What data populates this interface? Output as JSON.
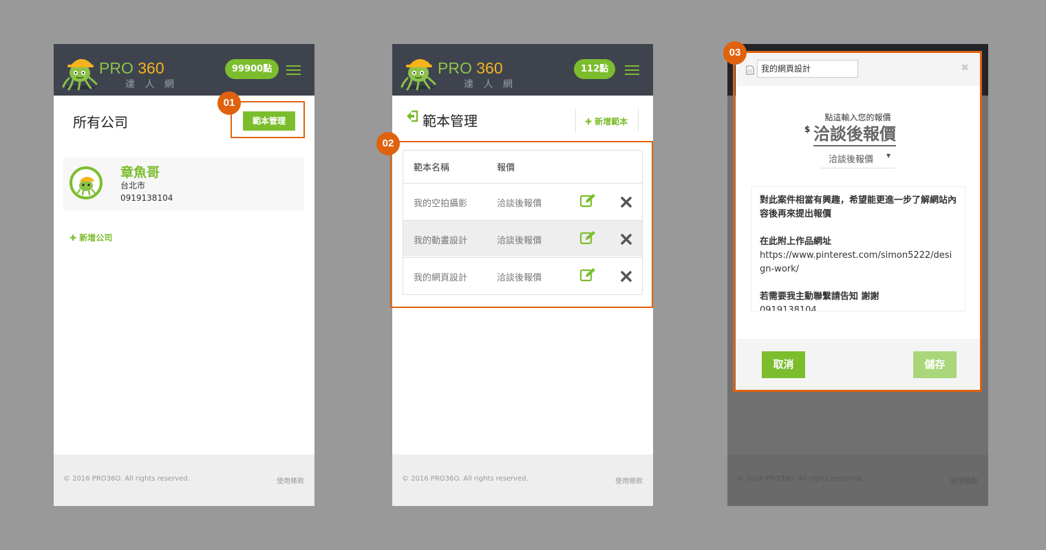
{
  "brand": {
    "name": "PRO",
    "name_num": "360",
    "subtitle": "達 人 網"
  },
  "colors": {
    "accent": "#7cbd2e",
    "accent_light": "#a9d77a",
    "header": "#3f434e",
    "annotation": "#e0620e",
    "brand_yellow": "#f5b41d"
  },
  "footer": {
    "copyright": "© 2016 PRO36O. All rights reserved.",
    "terms": "使用條款"
  },
  "screen1": {
    "points": "99900點",
    "title": "所有公司",
    "manage_button": "範本管理",
    "company": {
      "name": "章魚哥",
      "city": "台北市",
      "phone": "0919138104"
    },
    "add_company": "新增公司",
    "badge": "01"
  },
  "screen2": {
    "points": "112點",
    "title": "範本管理",
    "add_template": "新增範本",
    "columns": {
      "name": "範本名稱",
      "price": "報價"
    },
    "rows": [
      {
        "name": "我的空拍攝影",
        "price": "洽談後報價"
      },
      {
        "name": "我的動畫設計",
        "price": "洽談後報價"
      },
      {
        "name": "我的網頁設計",
        "price": "洽談後報價"
      }
    ],
    "badge": "02"
  },
  "screen3": {
    "template_name": "我的網頁設計",
    "close": "✖",
    "prompt": "點這輸入您的報價",
    "currency": "$",
    "price_text": "洽談後報價",
    "price_option": "洽談後報價",
    "message": {
      "p1": "對此案件相當有興趣，希望能更進一步了解網站內容後再來提出報價",
      "p2_title": "在此附上作品網址",
      "p2_url": "https://www.pinterest.com/simon5222/design-work/",
      "p3": "若需要我主動聯繫請告知 謝謝",
      "p4": "0919138104"
    },
    "cancel_button": "取消",
    "save_button": "儲存",
    "badge": "03"
  }
}
